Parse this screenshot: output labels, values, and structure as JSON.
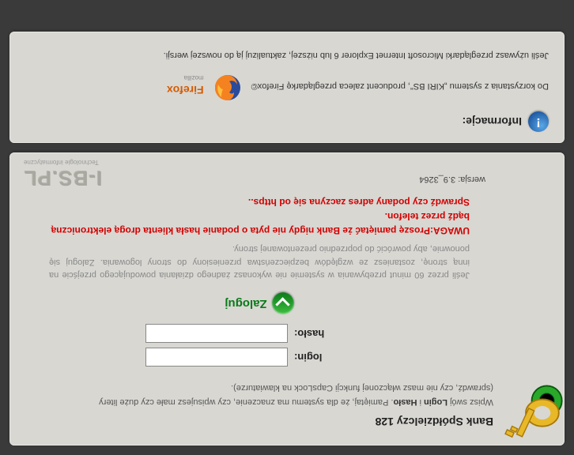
{
  "login": {
    "bank_title": "Bank Spółdzielczy 128",
    "instruction_pre": "Wpisz swój ",
    "instruction_login": "Login",
    "instruction_and": " i ",
    "instruction_haslo": "Hasło",
    "instruction_post": ". Pamiętaj, że dla systemu ma znaczenie, czy wpisujesz małe czy duże litery",
    "capslock_note": "(sprawdź, czy nie masz włączonej funkcji CapsLock na klawiaturze).",
    "login_label": "login:",
    "password_label": "hasło:",
    "button_label": "Zaloguj",
    "grey_note": "Jeśli przez 60 minut przebywania w systemie nie wykonasz żadnego działania powodującego przejście na inną stronę, zostaniesz ze względów bezpieczeństwa przeniesiony do strony logowania. Zaloguj się ponownie, aby powrócić do poprzednio prezentowanej strony.",
    "red_note_1": "UWAGA:Proszę pamiętać że Bank nigdy nie pyta o podanie hasła klienta drogą elektroniczną bądź przez telefon.",
    "red_note_2": "Sprawdź czy podany adres zaczyna się od https..",
    "version": "wersja: 3.9_3264"
  },
  "logo": {
    "name": "I-BS.PL",
    "tagline": "Technologie informatyczne"
  },
  "info": {
    "header": "Informacje:",
    "line1": "Do korzystania z systemu „KIRI BS\", producent zaleca przeglądarkę Firefox©",
    "firefox_label": "Firefox",
    "firefox_sub": "mozilla",
    "line2": "Jeśli używasz przeglądarki Microsoft Internet Explorer 6 lub niższej, zaktualizuj ją do nowszej wersji."
  }
}
